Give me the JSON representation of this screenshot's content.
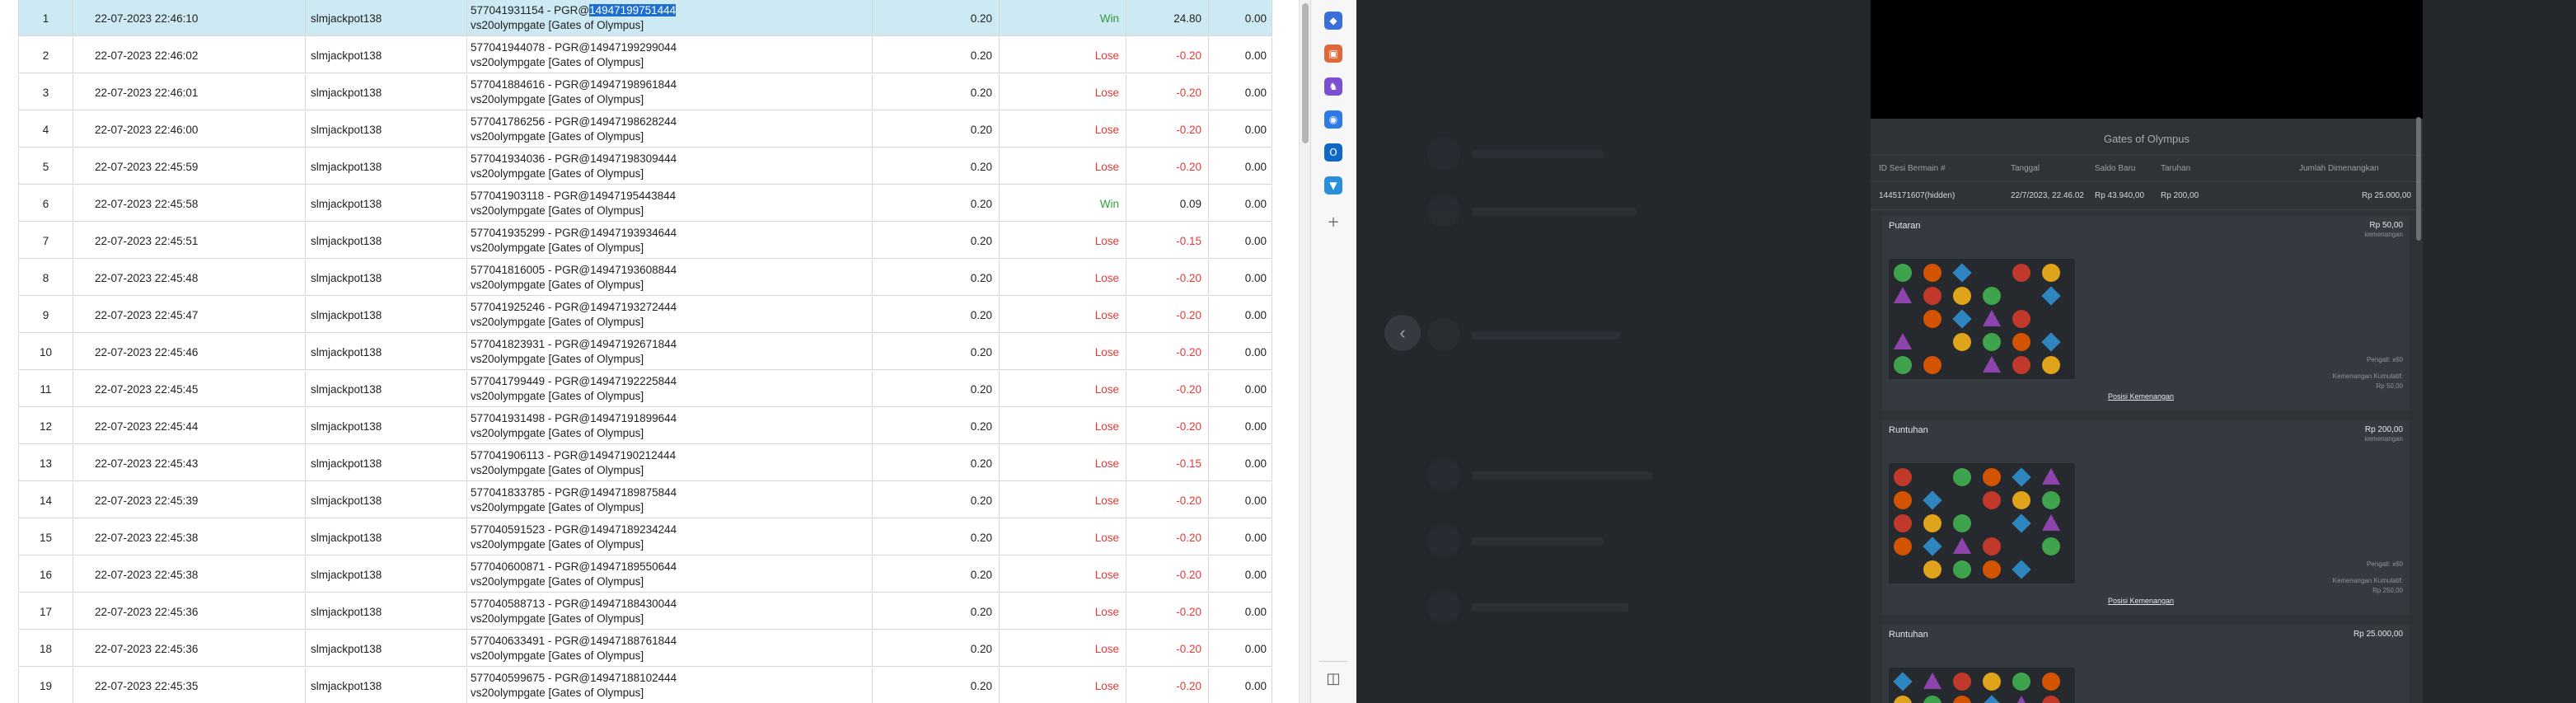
{
  "table": {
    "rows": [
      {
        "no": "1",
        "date": "22-07-2023 22:46:10",
        "user": "slmjackpot138",
        "ref_prefix": "577041931154 - PGR@",
        "ref_id": "14947199751444",
        "game": "vs20olympgate [Gates of Olympus]",
        "bet": "0.20",
        "result": "Win",
        "win": "24.80",
        "balance": "0.00"
      },
      {
        "no": "2",
        "date": "22-07-2023 22:46:02",
        "user": "slmjackpot138",
        "ref_prefix": "577041944078 - PGR@",
        "ref_id": "14947199299044",
        "game": "vs20olympgate [Gates of Olympus]",
        "bet": "0.20",
        "result": "Lose",
        "win": "-0.20",
        "balance": "0.00"
      },
      {
        "no": "3",
        "date": "22-07-2023 22:46:01",
        "user": "slmjackpot138",
        "ref_prefix": "577041884616 - PGR@",
        "ref_id": "14947198961844",
        "game": "vs20olympgate [Gates of Olympus]",
        "bet": "0.20",
        "result": "Lose",
        "win": "-0.20",
        "balance": "0.00"
      },
      {
        "no": "4",
        "date": "22-07-2023 22:46:00",
        "user": "slmjackpot138",
        "ref_prefix": "577041786256 - PGR@",
        "ref_id": "14947198628244",
        "game": "vs20olympgate [Gates of Olympus]",
        "bet": "0.20",
        "result": "Lose",
        "win": "-0.20",
        "balance": "0.00"
      },
      {
        "no": "5",
        "date": "22-07-2023 22:45:59",
        "user": "slmjackpot138",
        "ref_prefix": "577041934036 - PGR@",
        "ref_id": "14947198309444",
        "game": "vs20olympgate [Gates of Olympus]",
        "bet": "0.20",
        "result": "Lose",
        "win": "-0.20",
        "balance": "0.00"
      },
      {
        "no": "6",
        "date": "22-07-2023 22:45:58",
        "user": "slmjackpot138",
        "ref_prefix": "577041903118 - PGR@",
        "ref_id": "14947195443844",
        "game": "vs20olympgate [Gates of Olympus]",
        "bet": "0.20",
        "result": "Win",
        "win": "0.09",
        "balance": "0.00"
      },
      {
        "no": "7",
        "date": "22-07-2023 22:45:51",
        "user": "slmjackpot138",
        "ref_prefix": "577041935299 - PGR@",
        "ref_id": "14947193934644",
        "game": "vs20olympgate [Gates of Olympus]",
        "bet": "0.20",
        "result": "Lose",
        "win": "-0.15",
        "balance": "0.00"
      },
      {
        "no": "8",
        "date": "22-07-2023 22:45:48",
        "user": "slmjackpot138",
        "ref_prefix": "577041816005 - PGR@",
        "ref_id": "14947193608844",
        "game": "vs20olympgate [Gates of Olympus]",
        "bet": "0.20",
        "result": "Lose",
        "win": "-0.20",
        "balance": "0.00"
      },
      {
        "no": "9",
        "date": "22-07-2023 22:45:47",
        "user": "slmjackpot138",
        "ref_prefix": "577041925246 - PGR@",
        "ref_id": "14947193272444",
        "game": "vs20olympgate [Gates of Olympus]",
        "bet": "0.20",
        "result": "Lose",
        "win": "-0.20",
        "balance": "0.00"
      },
      {
        "no": "10",
        "date": "22-07-2023 22:45:46",
        "user": "slmjackpot138",
        "ref_prefix": "577041823931 - PGR@",
        "ref_id": "14947192671844",
        "game": "vs20olympgate [Gates of Olympus]",
        "bet": "0.20",
        "result": "Lose",
        "win": "-0.20",
        "balance": "0.00"
      },
      {
        "no": "11",
        "date": "22-07-2023 22:45:45",
        "user": "slmjackpot138",
        "ref_prefix": "577041799449 - PGR@",
        "ref_id": "14947192225844",
        "game": "vs20olympgate [Gates of Olympus]",
        "bet": "0.20",
        "result": "Lose",
        "win": "-0.20",
        "balance": "0.00"
      },
      {
        "no": "12",
        "date": "22-07-2023 22:45:44",
        "user": "slmjackpot138",
        "ref_prefix": "577041931498 - PGR@",
        "ref_id": "14947191899644",
        "game": "vs20olympgate [Gates of Olympus]",
        "bet": "0.20",
        "result": "Lose",
        "win": "-0.20",
        "balance": "0.00"
      },
      {
        "no": "13",
        "date": "22-07-2023 22:45:43",
        "user": "slmjackpot138",
        "ref_prefix": "577041906113 - PGR@",
        "ref_id": "14947190212444",
        "game": "vs20olympgate [Gates of Olympus]",
        "bet": "0.20",
        "result": "Lose",
        "win": "-0.15",
        "balance": "0.00"
      },
      {
        "no": "14",
        "date": "22-07-2023 22:45:39",
        "user": "slmjackpot138",
        "ref_prefix": "577041833785 - PGR@",
        "ref_id": "14947189875844",
        "game": "vs20olympgate [Gates of Olympus]",
        "bet": "0.20",
        "result": "Lose",
        "win": "-0.20",
        "balance": "0.00"
      },
      {
        "no": "15",
        "date": "22-07-2023 22:45:38",
        "user": "slmjackpot138",
        "ref_prefix": "577040591523 - PGR@",
        "ref_id": "14947189234244",
        "game": "vs20olympgate [Gates of Olympus]",
        "bet": "0.20",
        "result": "Lose",
        "win": "-0.20",
        "balance": "0.00"
      },
      {
        "no": "16",
        "date": "22-07-2023 22:45:38",
        "user": "slmjackpot138",
        "ref_prefix": "577040600871 - PGR@",
        "ref_id": "14947189550644",
        "game": "vs20olympgate [Gates of Olympus]",
        "bet": "0.20",
        "result": "Lose",
        "win": "-0.20",
        "balance": "0.00"
      },
      {
        "no": "17",
        "date": "22-07-2023 22:45:36",
        "user": "slmjackpot138",
        "ref_prefix": "577040588713 - PGR@",
        "ref_id": "14947188430044",
        "game": "vs20olympgate [Gates of Olympus]",
        "bet": "0.20",
        "result": "Lose",
        "win": "-0.20",
        "balance": "0.00"
      },
      {
        "no": "18",
        "date": "22-07-2023 22:45:36",
        "user": "slmjackpot138",
        "ref_prefix": "577040633491 - PGR@",
        "ref_id": "14947188761844",
        "game": "vs20olympgate [Gates of Olympus]",
        "bet": "0.20",
        "result": "Lose",
        "win": "-0.20",
        "balance": "0.00"
      },
      {
        "no": "19",
        "date": "22-07-2023 22:45:35",
        "user": "slmjackpot138",
        "ref_prefix": "577040599675 - PGR@",
        "ref_id": "14947188102444",
        "game": "vs20olympgate [Gates of Olympus]",
        "bet": "0.20",
        "result": "Lose",
        "win": "-0.20",
        "balance": "0.00"
      }
    ]
  },
  "colors": {
    "win": "#2e9e3a",
    "lose": "#e53935",
    "selected_row": "#cde9f3",
    "text_highlight": "#1f6fd1"
  },
  "browser_sidebar": {
    "icons": [
      {
        "name": "tag-icon",
        "glyph": "◆",
        "color": "#3b6fd8"
      },
      {
        "name": "toolbox-icon",
        "glyph": "▣",
        "color": "#e0683b"
      },
      {
        "name": "chess-icon",
        "glyph": "♞",
        "color": "#7b4fd1"
      },
      {
        "name": "copilot-icon",
        "glyph": "◉",
        "color": "#2f7ae5"
      },
      {
        "name": "outlook-icon",
        "glyph": "O",
        "color": "#1068c6"
      },
      {
        "name": "shopping-icon",
        "glyph": "▼",
        "color": "#2a8fd8"
      },
      {
        "name": "add-icon",
        "glyph": "+",
        "color": "#777777"
      },
      {
        "name": "sidebar-toggle-icon",
        "glyph": "◫",
        "color": "#555555"
      }
    ]
  },
  "back_button": {
    "glyph": "‹"
  },
  "history": {
    "title": "Gates of Olympus",
    "columns": [
      "ID Sesi Bermain #",
      "Tanggal",
      "Saldo Baru",
      "Taruhan",
      "Jumlah Dimenangkan"
    ],
    "values": [
      "1445171607(hidden)",
      "22/7/2023, 22.46.02",
      "Rp 43.940,00",
      "Rp 200,00",
      "Rp 25.000,00"
    ],
    "panels": [
      {
        "title": "Putaran",
        "amount": "Rp 50,00",
        "sub": "kemenangan",
        "note1": "Pengali: x60",
        "note2": "Kemenangan Kumulatif:",
        "note3": "Rp 50,00",
        "link": "Posisi Kemenangan"
      },
      {
        "title": "Runtuhan",
        "amount": "Rp 200,00",
        "sub": "kemenangan",
        "note1": "Pengali: x60",
        "note2": "Kemenangan Kumulatif:",
        "note3": "Rp 250,00",
        "link": "Posisi Kemenangan"
      },
      {
        "title": "Runtuhan",
        "amount": "Rp 25.000,00",
        "sub": "",
        "note1": "",
        "note2": "",
        "note3": "",
        "link": ""
      }
    ]
  }
}
